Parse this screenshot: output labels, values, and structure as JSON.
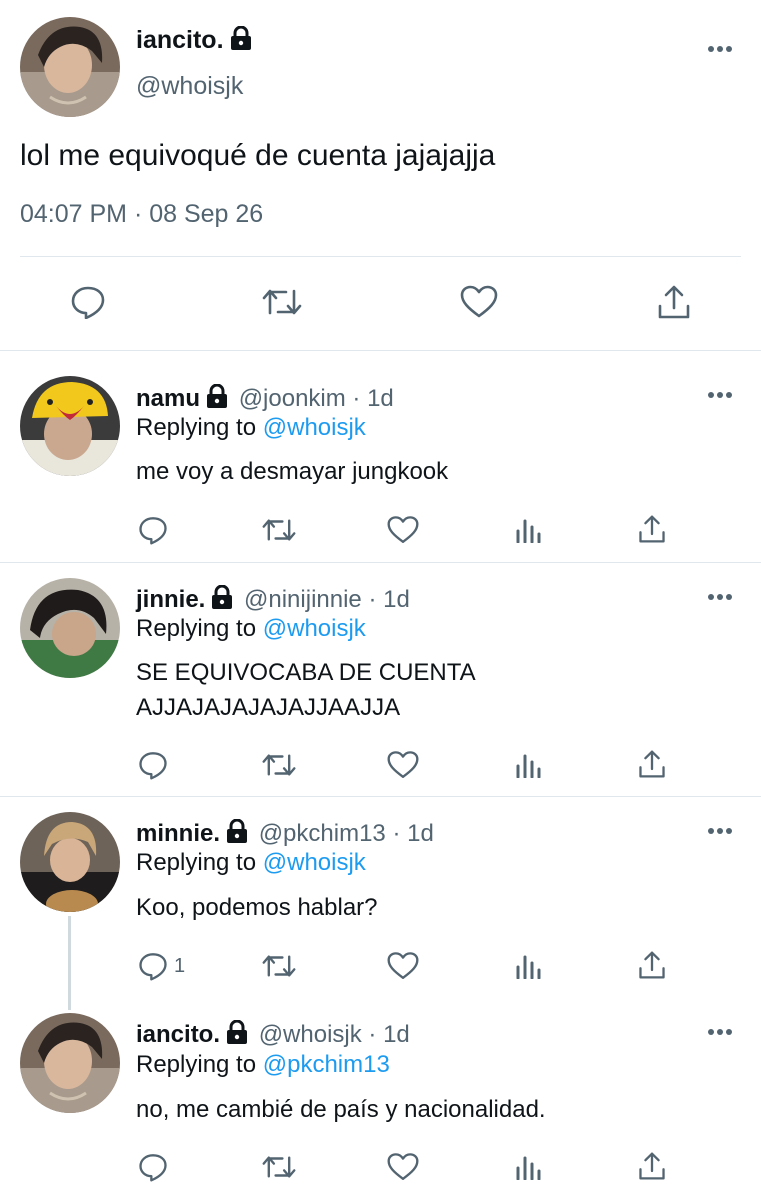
{
  "main_tweet": {
    "name": "iancito.",
    "handle": "@whoisjk",
    "text": "lol me equivoqué de cuenta jajajajja",
    "timestamp": "04:07 PM · 08 Sep 26"
  },
  "replies": [
    {
      "name": "namu",
      "handle": "@joonkim",
      "time": "· 1d",
      "replying_label": "Replying to",
      "replying_to": "@whoisjk",
      "text_lines": [
        "me voy a desmayar jungkook"
      ]
    },
    {
      "name": "jinnie.",
      "handle": "@ninijinnie",
      "time": "· 1d",
      "replying_label": "Replying to",
      "replying_to": "@whoisjk",
      "text_lines": [
        "SE EQUIVOCABA DE CUENTA",
        "AJJAJAJAJAJAJJAAJJA"
      ]
    },
    {
      "name": "minnie.",
      "handle": "@pkchim13",
      "time": "· 1d",
      "replying_label": "Replying to",
      "replying_to": "@whoisjk",
      "text_lines": [
        "Koo, podemos hablar?"
      ],
      "reply_count": "1"
    },
    {
      "name": "iancito.",
      "handle": "@whoisjk",
      "time": "· 1d",
      "replying_label": "Replying to",
      "replying_to": "@pkchim13",
      "text_lines": [
        "no, me cambié de país y nacionalidad."
      ]
    }
  ],
  "icons": {
    "reply": "reply-icon",
    "retweet": "retweet-icon",
    "like": "heart-icon",
    "views": "views-icon",
    "share": "share-icon",
    "more": "more-icon",
    "lock": "lock-icon"
  },
  "colors": {
    "link": "#1d9bf0",
    "muted": "#536471",
    "text": "#0f1419",
    "divider": "#e1e8ed"
  }
}
